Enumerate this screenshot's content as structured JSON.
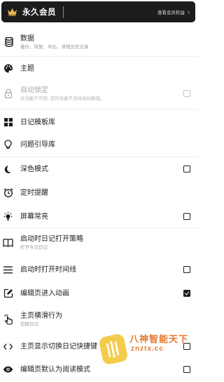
{
  "vip": {
    "title": "永久会员",
    "benefits": "查看会员权益",
    "icon": "crown-icon"
  },
  "rows": [
    {
      "label": "数据",
      "sub": "备份、恢复、导出、清理历史记录",
      "icon": "database-icon"
    },
    {
      "label": "主题",
      "icon": "palette-icon"
    },
    {
      "label": "自动锁定",
      "sub": "此功能不可用, 您的设备不支持指纹解锁。",
      "icon": "lock-icon",
      "checkbox": "disabled"
    },
    {
      "label": "日记模板库",
      "icon": "grid-icon"
    },
    {
      "label": "问题引导库",
      "icon": "lightbulb-icon"
    },
    {
      "label": "深色模式",
      "icon": "moon-icon",
      "checkbox": "unchecked"
    },
    {
      "label": "定时提醒",
      "icon": "alarm-icon"
    },
    {
      "label": "屏幕常亮",
      "icon": "light-icon",
      "checkbox": "unchecked"
    },
    {
      "label": "启动时日记打开策略",
      "sub": "打开今日日记",
      "icon": "book-icon"
    },
    {
      "label": "启动时打开时间线",
      "icon": "menu-icon",
      "checkbox": "unchecked"
    },
    {
      "label": "编辑页进入动画",
      "icon": "edit-icon",
      "checkbox": "checked"
    },
    {
      "label": "主页横滑行为",
      "sub": "切换日记",
      "icon": "swipe-icon"
    },
    {
      "label": "主页显示切换日记快捷键",
      "icon": "code-icon",
      "checkbox": "unchecked"
    },
    {
      "label": "编辑页默认为阅读模式",
      "icon": "eye-icon",
      "checkbox": "unchecked"
    }
  ],
  "watermark": {
    "text": "八神智能天下",
    "domain": "znztx.cc"
  }
}
